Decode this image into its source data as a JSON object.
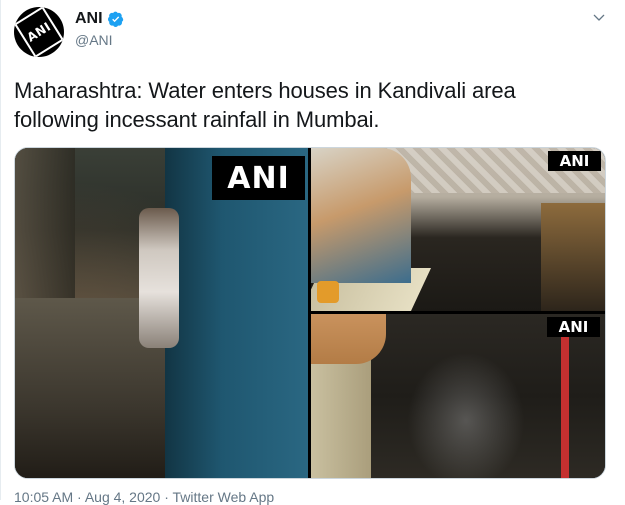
{
  "account": {
    "name": "ANI",
    "handle": "@ANI",
    "verified": true,
    "avatar_icon": "ani-logo-icon",
    "avatar_text": "ANI"
  },
  "tweet": {
    "text": "Maharashtra: Water enters houses in Kandivali area following incessant rainfall in Mumbai."
  },
  "media": {
    "watermark_label": "ANI",
    "images": [
      "flooded-house-doorway",
      "flooded-room-bed",
      "flooded-floor-closeup"
    ]
  },
  "footer": {
    "meta_partial": "10:05 AM · Aug 4, 2020 · Twitter Web App"
  },
  "colors": {
    "text": "#14171a",
    "secondary": "#657786",
    "verified_blue": "#1da1f2"
  }
}
